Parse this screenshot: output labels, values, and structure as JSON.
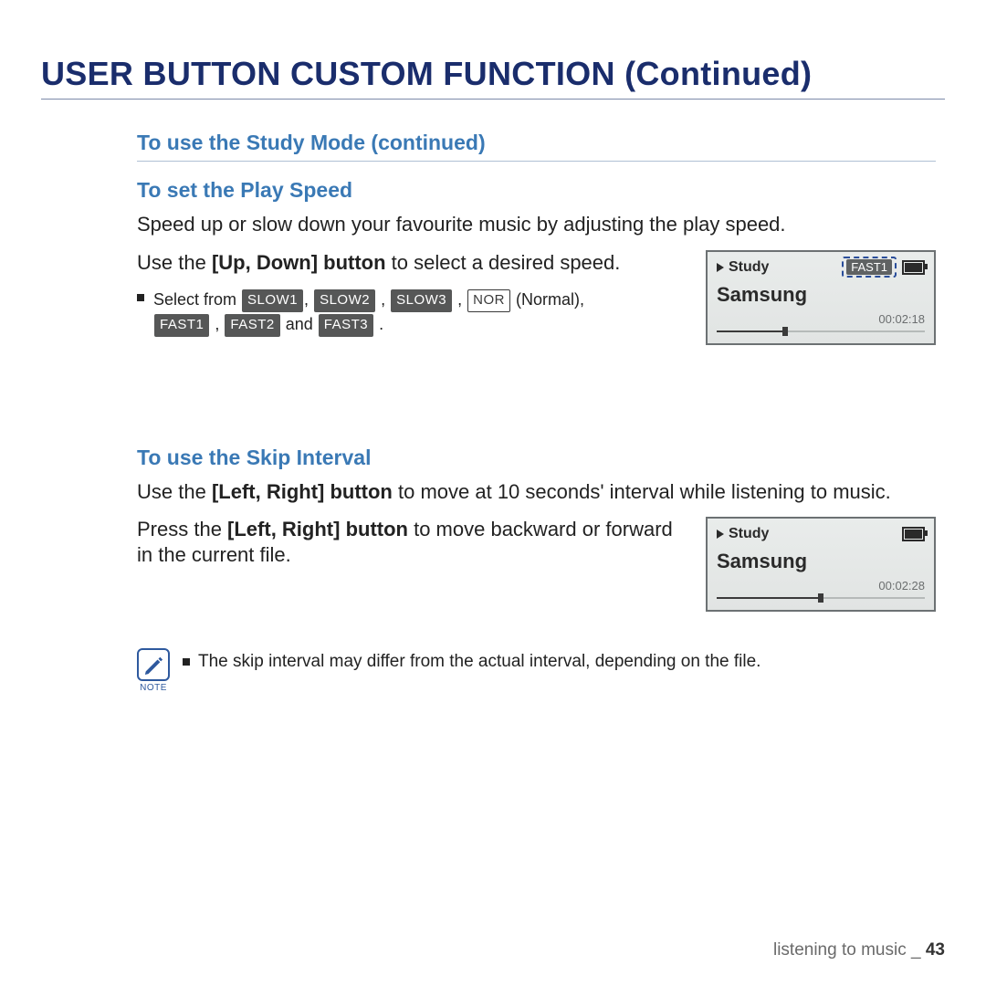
{
  "page_title": "USER BUTTON CUSTOM FUNCTION (Continued)",
  "top_section_heading": "To use the Study Mode (continued)",
  "play_speed": {
    "heading": "To set the Play Speed",
    "desc": "Speed up or slow down your favourite music by adjusting the play speed.",
    "instruction_pre": "Use the ",
    "instruction_bold": "[Up, Down] button",
    "instruction_post": " to select a desired speed.",
    "bullet_select_from": "Select from ",
    "normal_word": "(Normal)",
    "and_word": " and ",
    "tokens": {
      "slow1": "SLOW1",
      "slow2": "SLOW2",
      "slow3": "SLOW3",
      "nor": "NOR",
      "fast1": "FAST1",
      "fast2": "FAST2",
      "fast3": "FAST3"
    }
  },
  "skip_interval": {
    "heading": "To use the Skip Interval",
    "desc_pre": "Use the ",
    "desc_bold": "[Left, Right] button",
    "desc_post": " to move at 10 seconds' interval while listening to music.",
    "instr2_pre": "Press the ",
    "instr2_bold": "[Left, Right] button",
    "instr2_post": " to move backward or forward in the current file."
  },
  "note": {
    "label": "NOTE",
    "text": "The skip interval may differ from the actual interval, depending on the file."
  },
  "screens": {
    "s1": {
      "mode": "Study",
      "badge": "FAST1",
      "title": "Samsung",
      "time": "00:02:18",
      "progress_pct": 33
    },
    "s2": {
      "mode": "Study",
      "title": "Samsung",
      "time": "00:02:28",
      "progress_pct": 50
    }
  },
  "footer": {
    "section": "listening to music",
    "separator": "_",
    "page": "43"
  }
}
